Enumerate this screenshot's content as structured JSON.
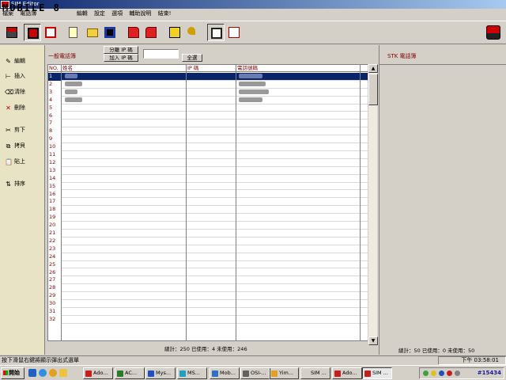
{
  "window": {
    "title": "SIM Editor"
  },
  "brand": {
    "text": "MOBILE 8"
  },
  "menu": [
    "檔案",
    "電話簿",
    "",
    "",
    "編輯",
    "設定",
    "選項",
    "輔助說明",
    "結束!"
  ],
  "toolbar_icons": [
    "phonebook-import-icon",
    "sim-card-icon",
    "sms-icon",
    "new-file-icon",
    "open-folder-icon",
    "save-icon",
    "read-sim-icon",
    "write-sim-icon",
    "sim-yellow-icon",
    "key-icon",
    "copy-list-icon",
    "edit-list-icon",
    "sim-editor-logo-icon"
  ],
  "sidebar": {
    "items": [
      {
        "label": "編輯",
        "icon": "edit-icon"
      },
      {
        "label": "插入",
        "icon": "insert-icon"
      },
      {
        "label": "清除",
        "icon": "eraser-icon"
      },
      {
        "label": "刪除",
        "icon": "delete-icon"
      },
      {
        "label": "剪下",
        "icon": "scissors-icon"
      },
      {
        "label": "拷貝",
        "icon": "copy-icon"
      },
      {
        "label": "貼上",
        "icon": "paste-icon"
      },
      {
        "label": "排序",
        "icon": "sort-icon"
      }
    ]
  },
  "phonebook": {
    "title": "一般電話簿",
    "split_ip_label": "分離 IP 碼",
    "add_ip_label": "加入 IP 碼",
    "ip_value": "",
    "select_all_label": "全選",
    "columns": [
      "NO.",
      "姓名",
      "IP 碼",
      "電話號碼"
    ],
    "rows": [
      1,
      2,
      3,
      4,
      5,
      6,
      7,
      8,
      9,
      10,
      11,
      12,
      13,
      14,
      15,
      16,
      17,
      18,
      19,
      20,
      21,
      22,
      23,
      24,
      25,
      26,
      27,
      28,
      29,
      30,
      31,
      32
    ],
    "filled_rows": 4,
    "selected_row": 1,
    "totals": "總計：250  已使用：4  未使用：246"
  },
  "stk": {
    "title": "STK 電話簿",
    "totals": "總計：50  已使用：0  未使用：50"
  },
  "status": {
    "hint": "按下滑鼠右鍵將顯示彈出式選單",
    "time": "下午 03:58:01"
  },
  "taskbar": {
    "start_label": "開始",
    "tasks": [
      "Ado...",
      "AC...",
      "Mys...",
      "MS...",
      "Mob...",
      "OSI-...",
      "Yim...",
      "SIM ...",
      "Ado...",
      "SIM ..."
    ],
    "active_task": 9,
    "clock": "#15434"
  },
  "colors": {
    "title_blue": "#0a246a",
    "header_red": "#800000",
    "sidebar_bg": "#e9e3c6",
    "face": "#d4d0c8"
  }
}
